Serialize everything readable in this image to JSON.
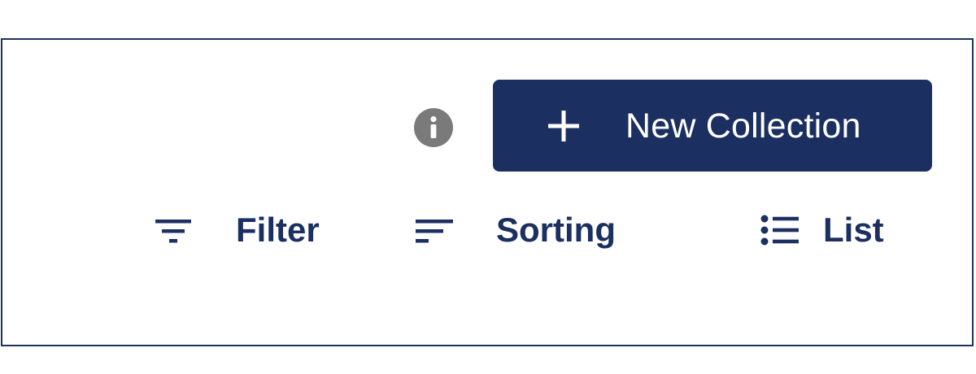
{
  "toolbar": {
    "info_icon": "info-icon",
    "new_collection": {
      "label": "New Collection",
      "icon": "plus-icon"
    },
    "filter": {
      "label": "Filter",
      "icon": "filter-icon"
    },
    "sorting": {
      "label": "Sorting",
      "icon": "sort-icon"
    },
    "list": {
      "label": "List",
      "icon": "list-icon"
    }
  },
  "colors": {
    "primary": "#1b2f60",
    "info_icon": "#7a7a7a",
    "background": "#ffffff"
  }
}
